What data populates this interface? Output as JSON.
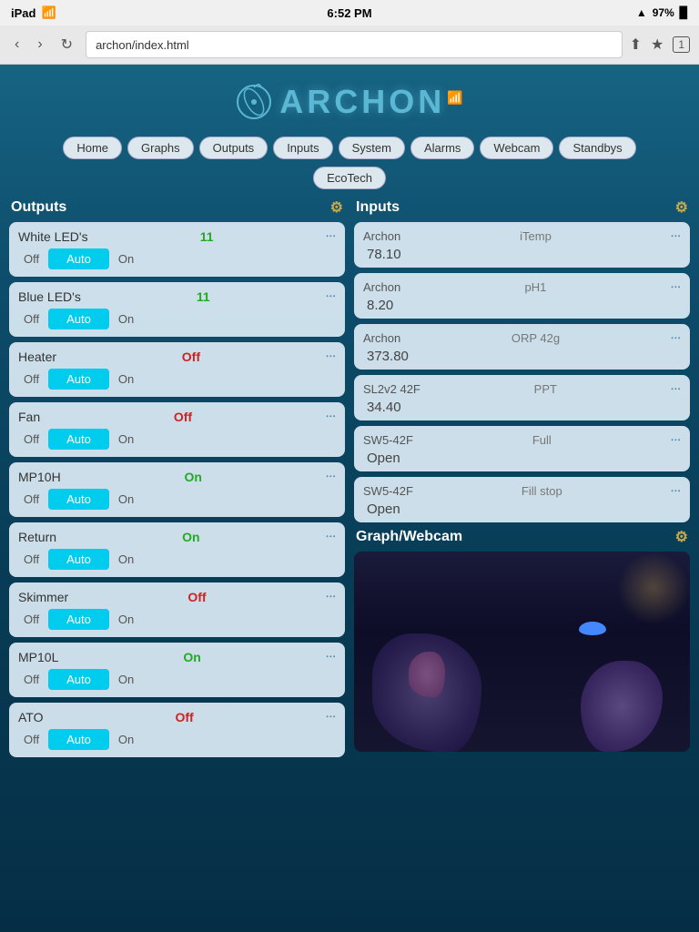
{
  "status_bar": {
    "left": "iPad",
    "time": "6:52 PM",
    "battery": "97%"
  },
  "browser": {
    "url": "archon/index.html",
    "tab_count": "1"
  },
  "header": {
    "logo_text": "ARCHON"
  },
  "nav": {
    "items": [
      {
        "label": "Home",
        "active": true
      },
      {
        "label": "Graphs"
      },
      {
        "label": "Outputs"
      },
      {
        "label": "Inputs"
      },
      {
        "label": "System"
      },
      {
        "label": "Alarms"
      },
      {
        "label": "Webcam"
      },
      {
        "label": "Standbys"
      }
    ],
    "sub_items": [
      {
        "label": "EcoTech"
      }
    ]
  },
  "outputs": {
    "title": "Outputs",
    "items": [
      {
        "name": "White LED's",
        "value": "11",
        "value_class": "val-green",
        "off": "Off",
        "auto": "Auto",
        "on": "On"
      },
      {
        "name": "Blue LED's",
        "value": "11",
        "value_class": "val-green",
        "off": "Off",
        "auto": "Auto",
        "on": "On"
      },
      {
        "name": "Heater",
        "value": "Off",
        "value_class": "val-red",
        "off": "Off",
        "auto": "Auto",
        "on": "On"
      },
      {
        "name": "Fan",
        "value": "Off",
        "value_class": "val-red",
        "off": "Off",
        "auto": "Auto",
        "on": "On"
      },
      {
        "name": "MP10H",
        "value": "On",
        "value_class": "val-green",
        "off": "Off",
        "auto": "Auto",
        "on": "On"
      },
      {
        "name": "Return",
        "value": "On",
        "value_class": "val-green",
        "off": "Off",
        "auto": "Auto",
        "on": "On"
      },
      {
        "name": "Skimmer",
        "value": "Off",
        "value_class": "val-red",
        "off": "Off",
        "auto": "Auto",
        "on": "On"
      },
      {
        "name": "MP10L",
        "value": "On",
        "value_class": "val-green",
        "off": "Off",
        "auto": "Auto",
        "on": "On"
      },
      {
        "name": "ATO",
        "value": "Off",
        "value_class": "val-red",
        "off": "Off",
        "auto": "Auto",
        "on": "On"
      }
    ]
  },
  "inputs": {
    "title": "Inputs",
    "items": [
      {
        "source": "Archon",
        "name": "iTemp",
        "value": "78.10"
      },
      {
        "source": "Archon",
        "name": "pH1",
        "value": "8.20"
      },
      {
        "source": "Archon",
        "name": "ORP 42g",
        "value": "373.80"
      },
      {
        "source": "SL2v2 42F",
        "name": "PPT",
        "value": "34.40"
      },
      {
        "source": "SW5-42F",
        "name": "Full",
        "value": "Open"
      },
      {
        "source": "SW5-42F",
        "name": "Fill stop",
        "value": "Open"
      }
    ]
  },
  "graph_webcam": {
    "title": "Graph/Webcam"
  }
}
